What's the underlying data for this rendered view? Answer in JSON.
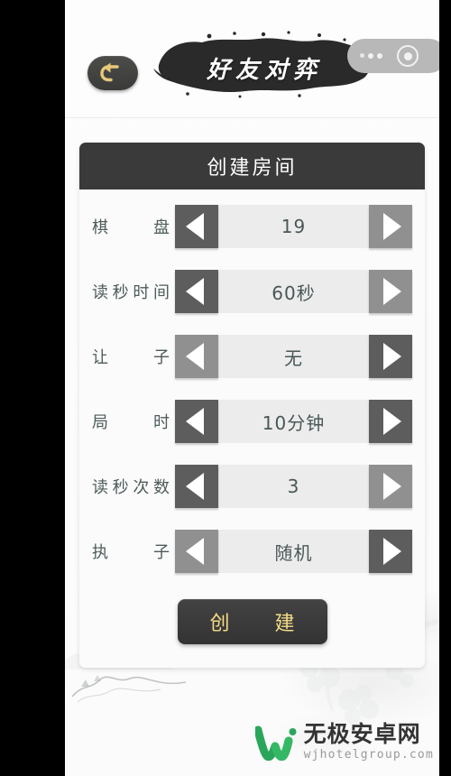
{
  "header": {
    "back_icon": "back-arrow-icon",
    "title": "好友对弈",
    "float_control": {
      "dots_icon": "three-dots-icon",
      "target_icon": "circle-target-icon"
    }
  },
  "dialog": {
    "title": "创建房间",
    "rows": [
      {
        "label": "棋　盘",
        "value": "19",
        "left_arrow_icon": "triangle-left-icon",
        "right_arrow_icon": "triangle-right-icon",
        "left_enabled": true,
        "right_enabled": false
      },
      {
        "label": "读秒时间",
        "value": "60秒",
        "left_arrow_icon": "triangle-left-icon",
        "right_arrow_icon": "triangle-right-icon",
        "left_enabled": true,
        "right_enabled": false
      },
      {
        "label": "让　子",
        "value": "无",
        "left_arrow_icon": "triangle-left-icon",
        "right_arrow_icon": "triangle-right-icon",
        "left_enabled": false,
        "right_enabled": true
      },
      {
        "label": "局　时",
        "value": "10分钟",
        "left_arrow_icon": "triangle-left-icon",
        "right_arrow_icon": "triangle-right-icon",
        "left_enabled": true,
        "right_enabled": true
      },
      {
        "label": "读秒次数",
        "value": "3",
        "left_arrow_icon": "triangle-left-icon",
        "right_arrow_icon": "triangle-right-icon",
        "left_enabled": true,
        "right_enabled": false
      },
      {
        "label": "执　子",
        "value": "随机",
        "left_arrow_icon": "triangle-left-icon",
        "right_arrow_icon": "triangle-right-icon",
        "left_enabled": false,
        "right_enabled": true
      }
    ],
    "create_button": "创　建"
  },
  "watermark": {
    "logo_icon": "w-logo-icon",
    "name": "无极安卓网",
    "url": "wjhotelgroup.com"
  },
  "colors": {
    "panel_header": "#3a3a3a",
    "arrow_enabled": "#5d5d5d",
    "arrow_disabled": "#909090",
    "stepper_track": "#ececec",
    "gold_text": "#f5dd87",
    "label_text": "#4e5b5b",
    "watermark_green": "#2aa65a"
  }
}
